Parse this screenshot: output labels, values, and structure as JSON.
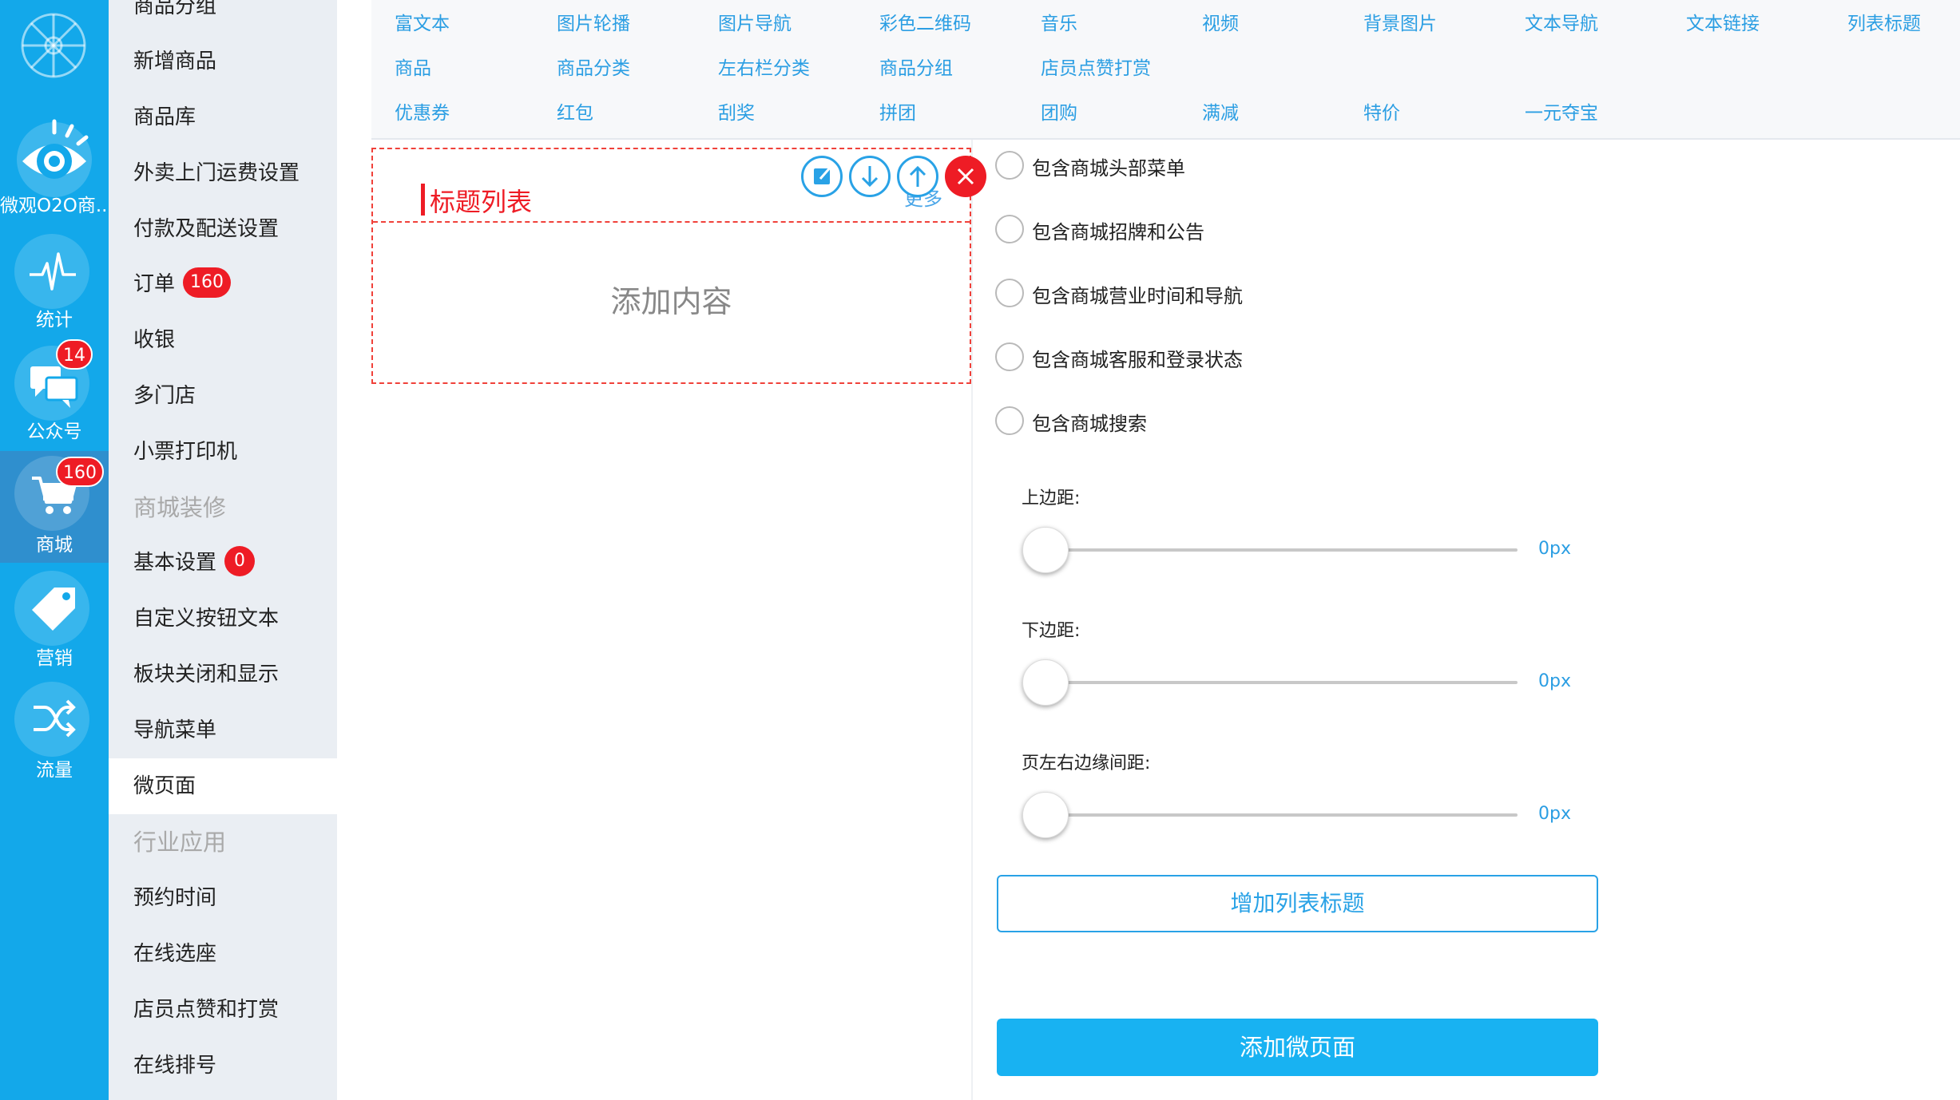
{
  "colors": {
    "rail_bg": "#13a8ea",
    "accent": "#2b9ee3",
    "danger": "#ee1c25",
    "primary_btn": "#18b2f2"
  },
  "rail": {
    "logo_icon": "wheel-logo-icon",
    "items": [
      {
        "label": "微观O2O商...",
        "icon": "eye-icon"
      },
      {
        "label": "统计",
        "icon": "pulse-icon"
      },
      {
        "label": "公众号",
        "icon": "chat-bubbles-icon",
        "badge": "14"
      },
      {
        "label": "商城",
        "icon": "cart-icon",
        "badge": "160"
      },
      {
        "label": "营销",
        "icon": "tag-icon"
      },
      {
        "label": "流量",
        "icon": "shuffle-icon"
      }
    ]
  },
  "subnav": {
    "items": [
      {
        "label": "商品分组"
      },
      {
        "label": "新增商品"
      },
      {
        "label": "商品库"
      },
      {
        "label": "外卖上门运费设置"
      },
      {
        "label": "付款及配送设置"
      },
      {
        "label": "订单",
        "badge": "160"
      },
      {
        "label": "收银"
      },
      {
        "label": "多门店"
      },
      {
        "label": "小票打印机"
      },
      {
        "label": "商城装修"
      },
      {
        "label": "基本设置",
        "badge": "0"
      },
      {
        "label": "自定义按钮文本"
      },
      {
        "label": "板块关闭和显示"
      },
      {
        "label": "导航菜单"
      },
      {
        "label": "微页面"
      },
      {
        "label": "行业应用"
      },
      {
        "label": "预约时间"
      },
      {
        "label": "在线选座"
      },
      {
        "label": "店员点赞和打赏"
      },
      {
        "label": "在线排号"
      }
    ]
  },
  "palette": {
    "rows": [
      [
        "富文本",
        "图片轮播",
        "图片导航",
        "彩色二维码",
        "音乐",
        "视频",
        "背景图片",
        "文本导航",
        "文本链接",
        "列表标题"
      ],
      [
        "商品",
        "商品分类",
        "左右栏分类",
        "商品分组",
        "店员点赞打赏"
      ],
      [
        "优惠券",
        "红包",
        "刮奖",
        "拼团",
        "团购",
        "满减",
        "特价",
        "一元夺宝"
      ]
    ]
  },
  "preview": {
    "title": "标题列表",
    "more": "更多",
    "add_content": "添加内容",
    "tools": [
      "edit-icon",
      "arrow-down-icon",
      "arrow-up-icon",
      "close-icon"
    ]
  },
  "settings": {
    "options": [
      "包含商城头部菜单",
      "包含商城招牌和公告",
      "包含商城营业时间和导航",
      "包含商城客服和登录状态",
      "包含商城搜索"
    ],
    "sliders": [
      {
        "label": "上边距:",
        "value": "0px",
        "fraction": 0
      },
      {
        "label": "下边距:",
        "value": "0px",
        "fraction": 0
      },
      {
        "label": "页左右边缘间距:",
        "value": "0px",
        "fraction": 0
      }
    ],
    "add_title_button": "增加列表标题",
    "submit_button": "添加微页面"
  }
}
